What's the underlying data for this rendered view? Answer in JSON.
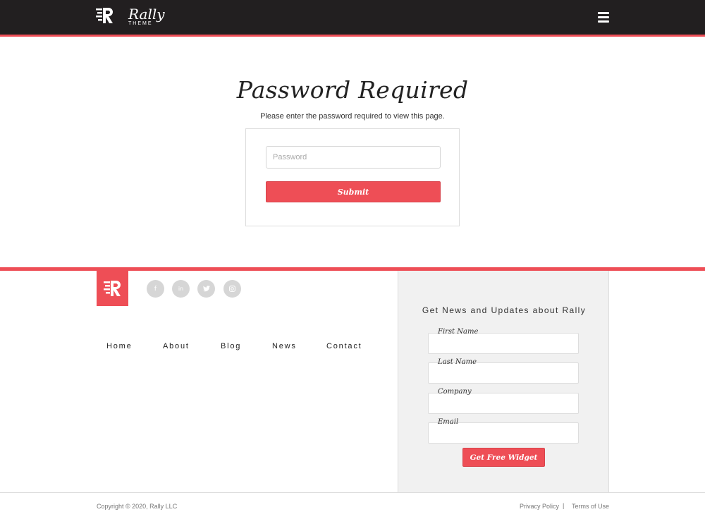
{
  "header": {
    "logo_name": "Rally",
    "logo_sub": "THEME",
    "menu_icon": "hamburger-icon"
  },
  "main": {
    "title": "Password Required",
    "subtitle": "Please enter the password required to view this page.",
    "password_placeholder": "Password",
    "submit_label": "Submit"
  },
  "footer": {
    "social_icons": [
      {
        "name": "facebook-icon",
        "glyph": "f"
      },
      {
        "name": "linkedin-icon",
        "glyph": "in"
      },
      {
        "name": "twitter-icon",
        "glyph": "🐦"
      },
      {
        "name": "instagram-icon",
        "glyph": "◎"
      }
    ],
    "nav": [
      "Home",
      "About",
      "Blog",
      "News",
      "Contact"
    ],
    "newsletter": {
      "title": "Get News and Updates about Rally",
      "fields": [
        "First Name",
        "Last Name",
        "Company",
        "Email"
      ],
      "button_label": "Get Free Widget"
    },
    "copyright": "Copyright © 2020, Rally LLC",
    "privacy": "Privacy Policy",
    "separator": "|",
    "terms": "Terms of Use"
  },
  "colors": {
    "accent": "#ee4e56",
    "header_bg": "#221f20",
    "social_bg": "#d6d6d6",
    "newsletter_bg": "#f1f1f1"
  }
}
